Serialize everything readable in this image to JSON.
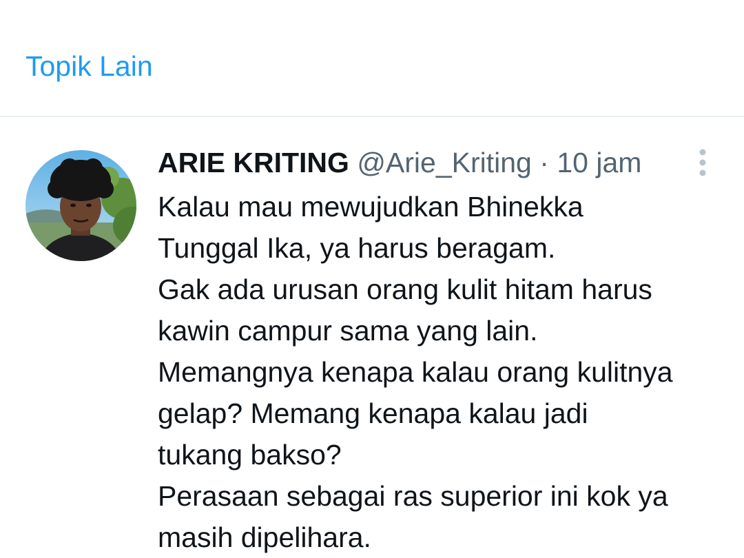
{
  "header": {
    "topik_link": "Topik Lain"
  },
  "tweet": {
    "author_name": "ARIE KRITING",
    "author_handle": "@Arie_Kriting",
    "separator": "·",
    "time": "10 jam",
    "more_icon": "more-vertical-icon",
    "lines": [
      "Kalau mau mewujudkan Bhinekka",
      "Tunggal Ika, ya harus beragam.",
      "Gak ada urusan orang kulit hitam harus",
      "kawin campur sama yang lain.",
      "Memangnya kenapa kalau orang kulitnya",
      "gelap? Memang kenapa kalau jadi",
      "tukang bakso?",
      "Perasaan sebagai ras superior ini kok ya",
      "masih dipelihara."
    ]
  },
  "colors": {
    "link": "#1d9bf0",
    "text_primary": "#0f1419",
    "text_secondary": "#536471",
    "divider": "#e6ecf0"
  }
}
